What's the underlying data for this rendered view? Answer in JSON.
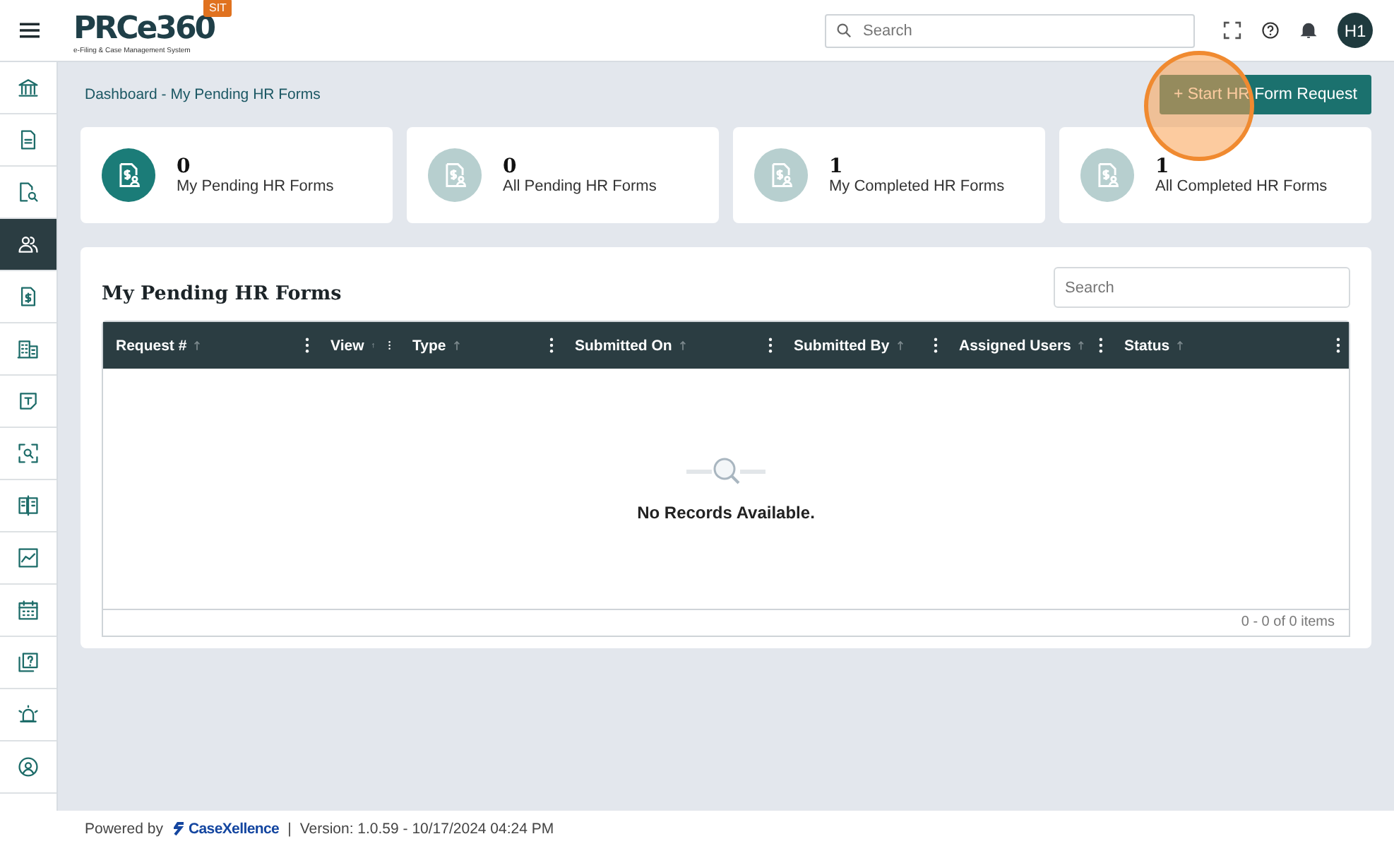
{
  "header": {
    "logo": "PRCe360",
    "logo_subtitle": "e-Filing & Case Management System",
    "env_badge": "SIT",
    "search": {
      "placeholder": "Search"
    },
    "avatar": "H1"
  },
  "sidebar": {
    "items": [
      {
        "selected": false
      },
      {
        "selected": false
      },
      {
        "selected": false
      },
      {
        "selected": true
      },
      {
        "selected": false
      },
      {
        "selected": false
      },
      {
        "selected": false
      },
      {
        "selected": false
      },
      {
        "selected": false
      },
      {
        "selected": false
      },
      {
        "selected": false
      },
      {
        "selected": false
      },
      {
        "selected": false
      },
      {
        "selected": false
      }
    ]
  },
  "breadcrumb": "Dashboard - My Pending HR Forms",
  "start_button": "+ Start HR Form Request",
  "cards": [
    {
      "count": "0",
      "label": "My Pending HR Forms",
      "selected": true
    },
    {
      "count": "0",
      "label": "All Pending HR Forms",
      "selected": false
    },
    {
      "count": "1",
      "label": "My Completed HR Forms",
      "selected": false
    },
    {
      "count": "1",
      "label": "All Completed HR Forms",
      "selected": false
    }
  ],
  "panel": {
    "title": "My Pending HR Forms",
    "search": {
      "placeholder": "Search"
    },
    "table": {
      "columns": [
        "Request #",
        "View",
        "Type",
        "Submitted On",
        "Submitted By",
        "Assigned Users",
        "Status"
      ],
      "empty_text": "No Records Available.",
      "pager": "0 - 0 of 0 items"
    }
  },
  "footer": {
    "powered_by": "Powered by",
    "brand": "CaseXellence",
    "separator": "|",
    "version": "Version: 1.0.59 - 10/17/2024 04:24 PM"
  }
}
